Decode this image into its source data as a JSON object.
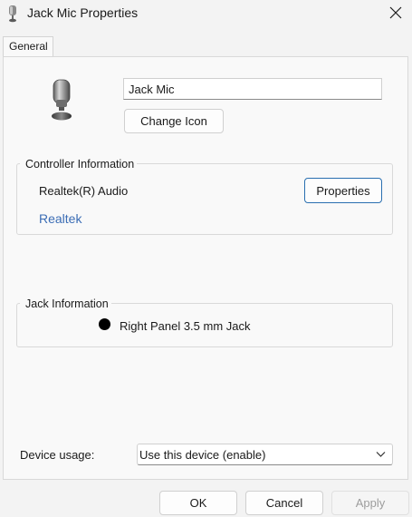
{
  "window": {
    "title": "Jack Mic Properties",
    "title_icon": "microphone-icon",
    "close_icon": "close-icon"
  },
  "tabs": [
    {
      "label": "General",
      "selected": true
    }
  ],
  "general": {
    "device_icon": "microphone-icon",
    "device_name": "Jack Mic",
    "change_icon_label": "Change Icon",
    "controller": {
      "legend": "Controller Information",
      "name": "Realtek(R) Audio",
      "vendor_link": "Realtek",
      "properties_label": "Properties"
    },
    "jack": {
      "legend": "Jack Information",
      "color": "#000000",
      "label": "Right Panel 3.5 mm Jack"
    },
    "device_usage": {
      "label": "Device usage:",
      "selected": "Use this device (enable)",
      "chevron_icon": "chevron-down-icon"
    }
  },
  "footer": {
    "ok_label": "OK",
    "cancel_label": "Cancel",
    "apply_label": "Apply",
    "apply_enabled": false
  },
  "colors": {
    "link": "#3b6db5",
    "focus_border": "#2a6fb0",
    "window_bg": "#f3f3f3",
    "panel_bg": "#f9f9f9"
  }
}
